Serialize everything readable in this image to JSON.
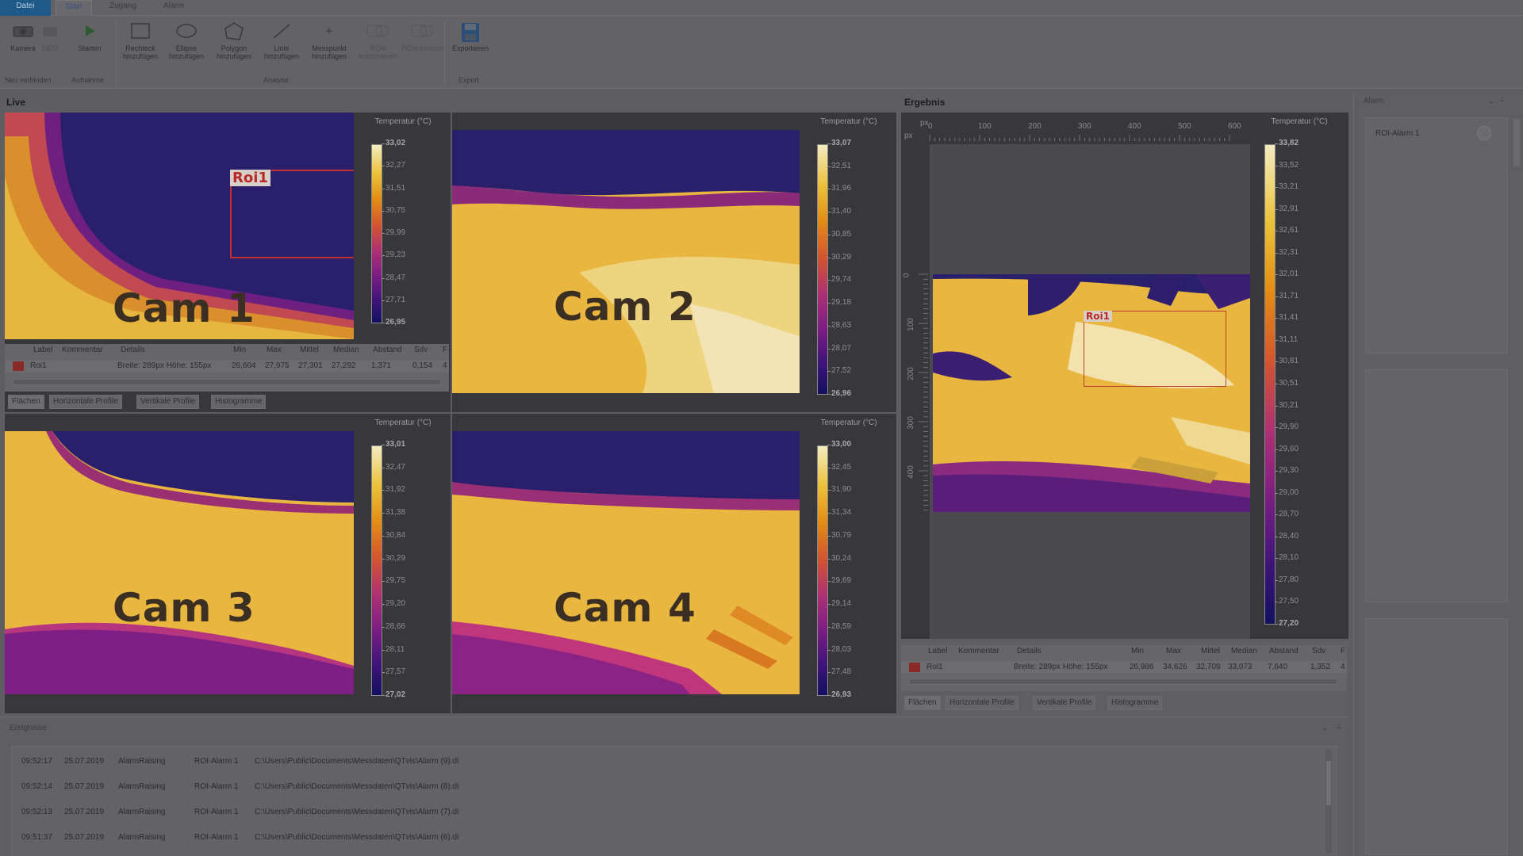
{
  "ribbon": {
    "tabs": [
      "Datei",
      "Start",
      "Zugang",
      "Alarm"
    ],
    "buttons": [
      {
        "label": "Kamera",
        "icon": "camera-icon"
      },
      {
        "label": "DEO",
        "icon": "disconnect-icon"
      },
      {
        "label": "Starten",
        "icon": "play-icon"
      },
      {
        "label": "Rechteck hinzufügen",
        "icon": "rectangle-icon"
      },
      {
        "label": "Ellipse hinzufügen",
        "icon": "ellipse-icon"
      },
      {
        "label": "Polygon hinzufügen",
        "icon": "polygon-icon"
      },
      {
        "label": "Linie hinzufügen",
        "icon": "line-icon"
      },
      {
        "label": "Messpunkt hinzufügen",
        "icon": "point-icon"
      },
      {
        "label": "ROIs kombinieren",
        "icon": "combine-icon"
      },
      {
        "label": "ROIs trennen",
        "icon": "split-icon"
      },
      {
        "label": "Exportieren",
        "icon": "save-icon"
      }
    ],
    "groups": [
      "Neu verbinden",
      "Aufnahme",
      "Analyse",
      "Export"
    ]
  },
  "panels": {
    "live": "Live",
    "ergebnis": "Ergebnis",
    "alarm": "Alarm",
    "ereignisse": "Ereignisse"
  },
  "scale_title": "Temperatur (°C)",
  "cams": [
    {
      "label": "Cam 1",
      "ticks": [
        "33,02",
        "32,27",
        "31,51",
        "30,75",
        "29,99",
        "29,23",
        "28,47",
        "27,71",
        "26,95"
      ]
    },
    {
      "label": "Cam 2",
      "ticks": [
        "33,07",
        "32,51",
        "31,96",
        "31,40",
        "30,85",
        "30,29",
        "29,74",
        "29,18",
        "28,63",
        "28,07",
        "27,52",
        "26,96"
      ]
    },
    {
      "label": "Cam 3",
      "ticks": [
        "33,01",
        "32,47",
        "31,92",
        "31,38",
        "30,84",
        "30,29",
        "29,75",
        "29,20",
        "28,66",
        "28,11",
        "27,57",
        "27,02"
      ]
    },
    {
      "label": "Cam 4",
      "ticks": [
        "33,00",
        "32,45",
        "31,90",
        "31,34",
        "30,79",
        "30,24",
        "29,69",
        "29,14",
        "28,59",
        "28,03",
        "27,48",
        "26,93"
      ]
    }
  ],
  "roi_label": "Roi1",
  "table_headers": [
    "Label",
    "Kommentar",
    "Details",
    "Min",
    "Max",
    "Mittel",
    "Median",
    "Abstand",
    "Sdv",
    "F"
  ],
  "live_row": {
    "label": "Roi1",
    "details": "Breite: 289px Höhe: 155px",
    "min": "26,604",
    "max": "27,975",
    "mittel": "27,301",
    "median": "27,292",
    "abstand": "1,371",
    "sdv": "0,154",
    "extra": "4"
  },
  "result_row": {
    "label": "Roi1",
    "details": "Breite: 289px Höhe: 155px",
    "min": "26,986",
    "max": "34,626",
    "mittel": "32,709",
    "median": "33,073",
    "abstand": "7,640",
    "sdv": "1,352",
    "extra": "4"
  },
  "bottom_tabs": [
    "Flächen",
    "Horizontale Profile",
    "Vertikale Profile",
    "Histogramme"
  ],
  "result": {
    "ruler_unit": "px",
    "ruler_x": [
      "0",
      "100",
      "200",
      "300",
      "400",
      "500",
      "600"
    ],
    "ruler_y": [
      "0",
      "100",
      "200",
      "300",
      "400"
    ],
    "ticks": [
      "33,82",
      "33,52",
      "33,21",
      "32,91",
      "32,61",
      "32,31",
      "32,01",
      "31,71",
      "31,41",
      "31,11",
      "30,81",
      "30,51",
      "30,21",
      "29,90",
      "29,60",
      "29,30",
      "29,00",
      "28,70",
      "28,40",
      "28,10",
      "27,80",
      "27,50",
      "27,20"
    ]
  },
  "alarm": {
    "item": "ROI-Alarm 1"
  },
  "events": [
    {
      "time": "09:52:17",
      "date": "25.07.2019",
      "type": "AlarmRaising",
      "source": "ROI-Alarm 1",
      "path": "C:\\Users\\Public\\Documents\\Messdaten\\QTvis\\Alarm (9).di"
    },
    {
      "time": "09:52:14",
      "date": "25.07.2019",
      "type": "AlarmRaising",
      "source": "ROI-Alarm 1",
      "path": "C:\\Users\\Public\\Documents\\Messdaten\\QTvis\\Alarm (8).di"
    },
    {
      "time": "09:52:13",
      "date": "25.07.2019",
      "type": "AlarmRaising",
      "source": "ROI-Alarm 1",
      "path": "C:\\Users\\Public\\Documents\\Messdaten\\QTvis\\Alarm (7).di"
    },
    {
      "time": "09:51:37",
      "date": "25.07.2019",
      "type": "AlarmRaising",
      "source": "ROI-Alarm 1",
      "path": "C:\\Users\\Public\\Documents\\Messdaten\\QTvis\\Alarm (6).di"
    }
  ],
  "colors": {
    "accent": "#1d5a8a",
    "roi": "#c03030",
    "dim_overlay": "#5e5e60"
  }
}
